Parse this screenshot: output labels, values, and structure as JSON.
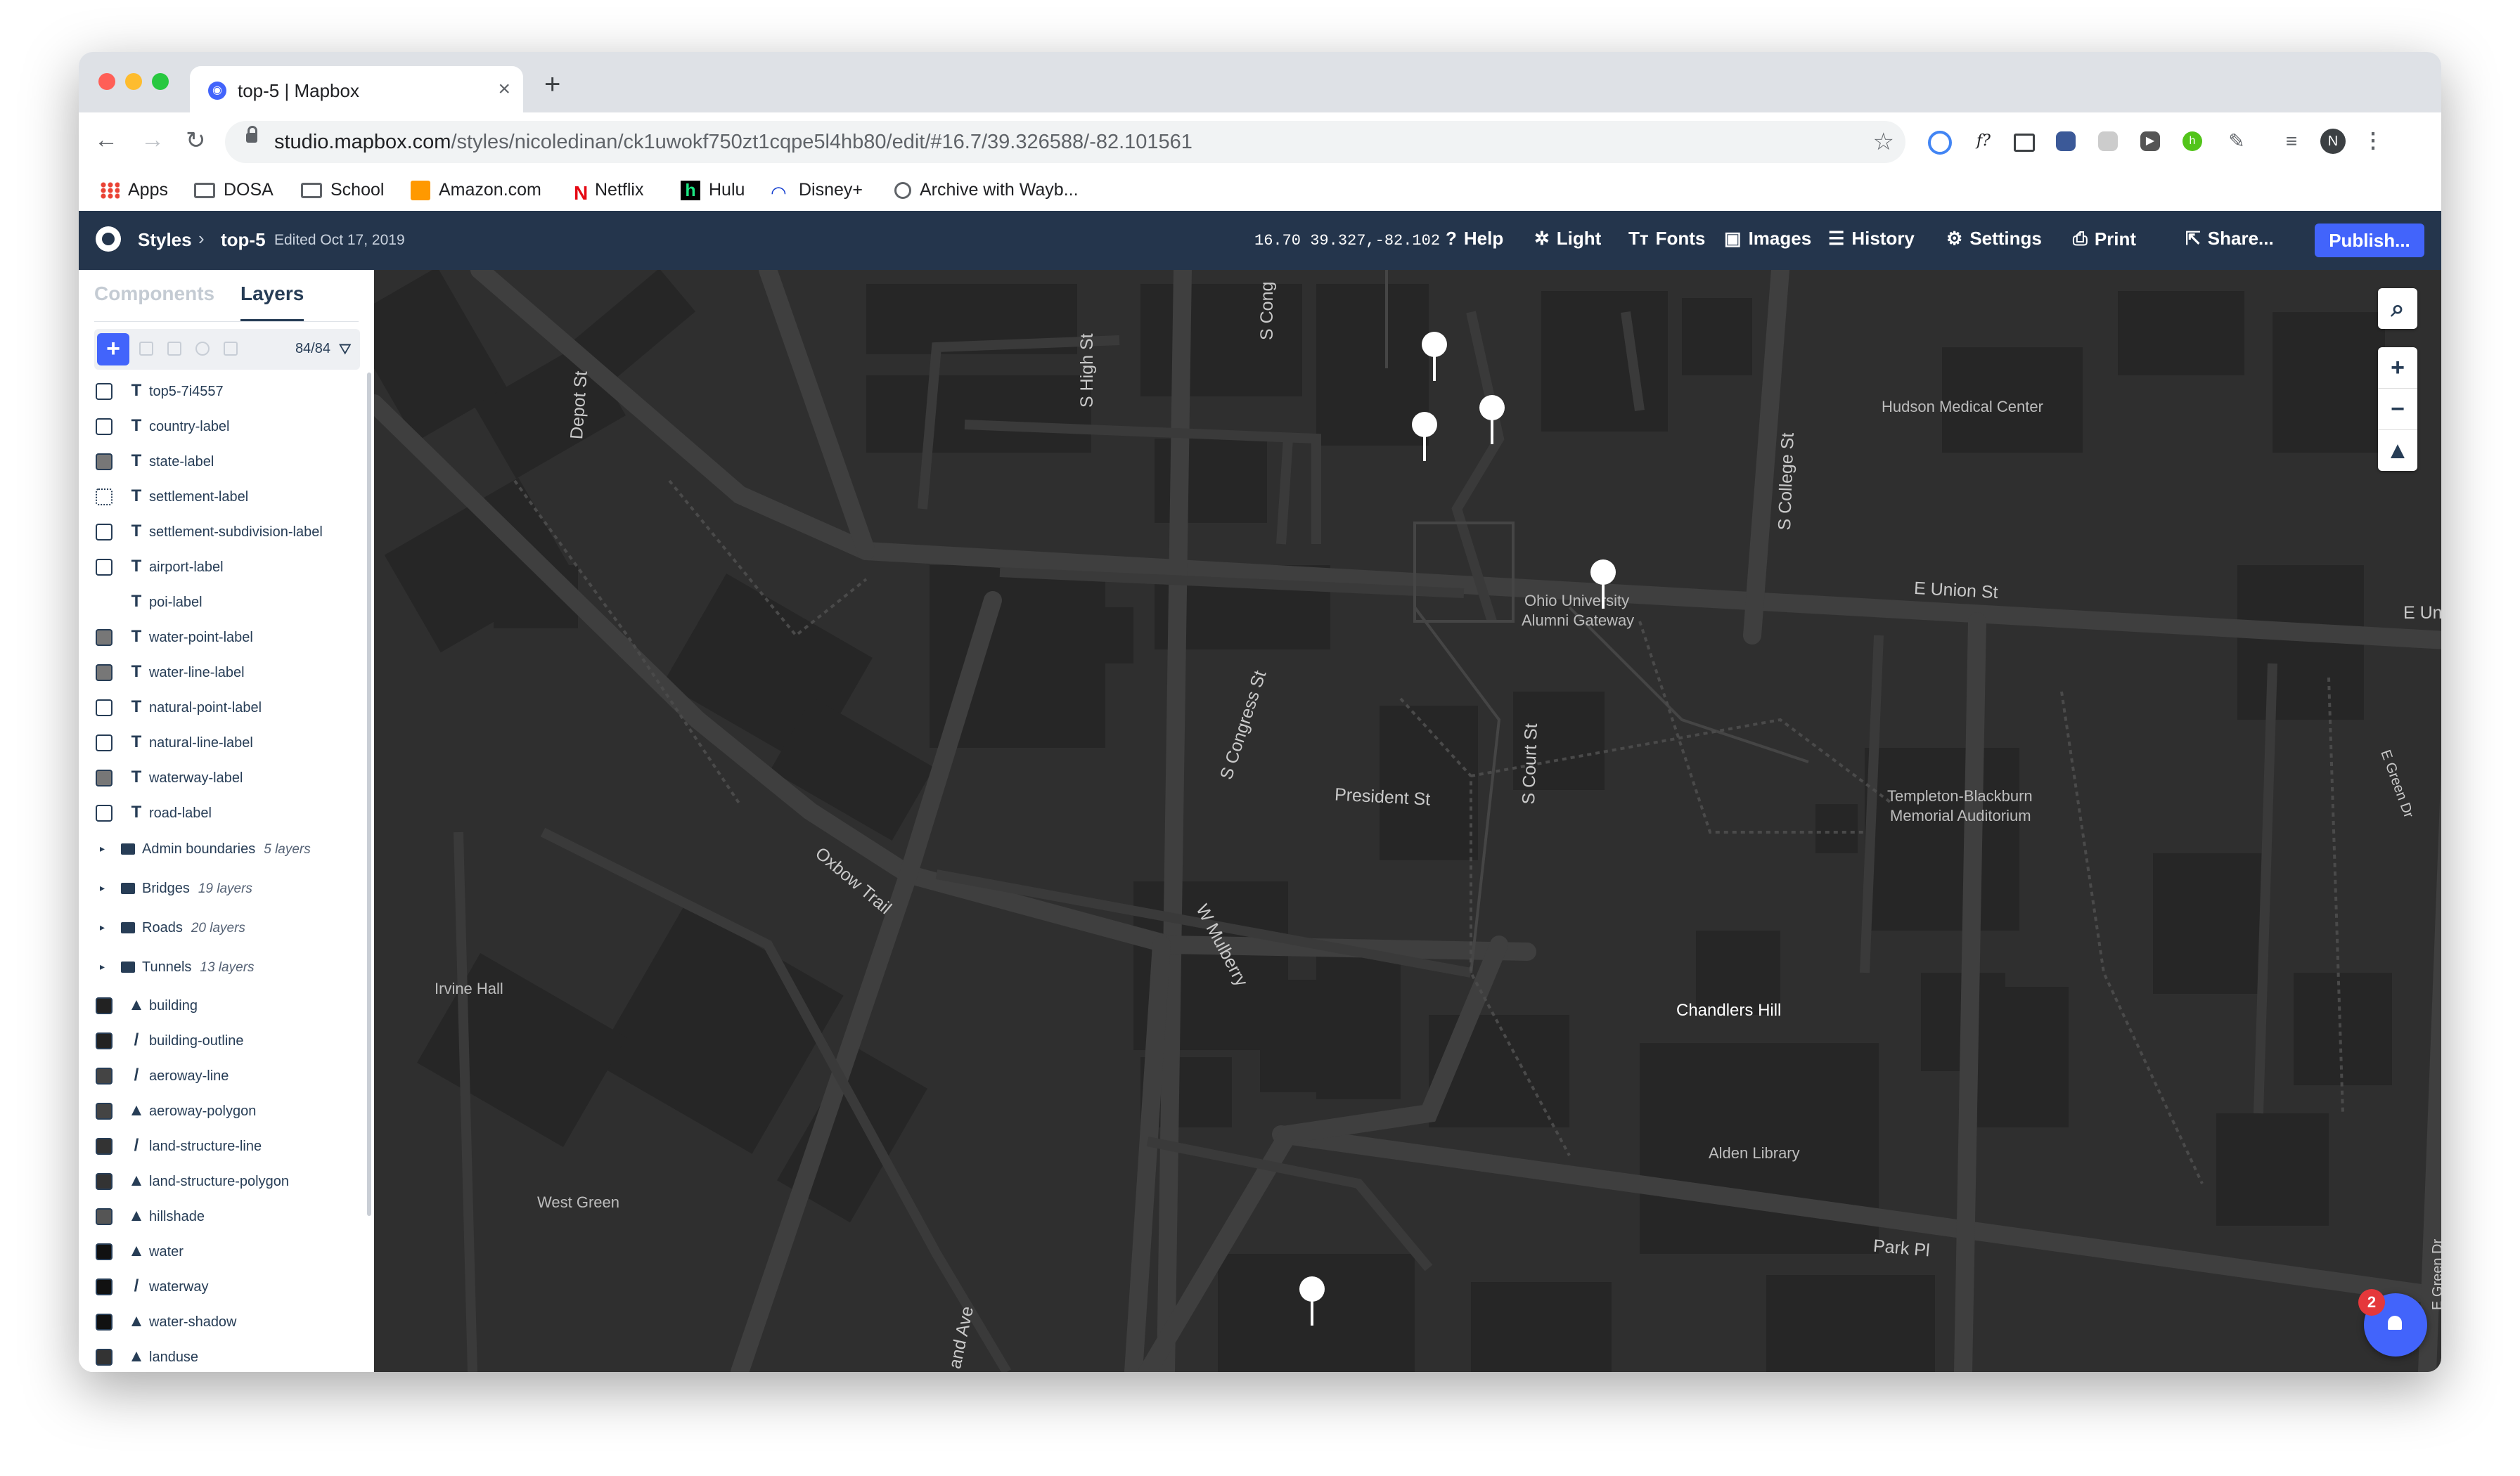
{
  "browser": {
    "tab_title": "top-5 | Mapbox",
    "tab_close": "×",
    "new_tab": "+",
    "url_host": "studio.mapbox.com",
    "url_path": "/styles/nicoledinan/ck1uwokf750zt1cqpe5l4hb80/edit/#16.7/39.326588/-82.101561",
    "profile_initial": "N",
    "bookmarks": [
      "Apps",
      "DOSA",
      "School",
      "Amazon.com",
      "Netflix",
      "Hulu",
      "Disney+",
      "Archive with Wayb..."
    ]
  },
  "header": {
    "styles_label": "Styles",
    "style_name": "top-5",
    "edited": "Edited Oct 17, 2019",
    "coords": "16.70  39.327,-82.102",
    "help": "Help",
    "light": "Light",
    "fonts": "Fonts",
    "images": "Images",
    "history": "History",
    "settings": "Settings",
    "print": "Print",
    "share": "Share...",
    "publish": "Publish..."
  },
  "sidebar": {
    "tab_components": "Components",
    "tab_layers": "Layers",
    "layer_count": "84/84",
    "add_icon": "+",
    "layers": [
      {
        "name": "top5-7i4557",
        "type": "T",
        "swatch": "#ffffff"
      },
      {
        "name": "country-label",
        "type": "T",
        "swatch": "#ffffff"
      },
      {
        "name": "state-label",
        "type": "T",
        "swatch": "#777777"
      },
      {
        "name": "settlement-label",
        "type": "T",
        "swatch": "#ffffff"
      },
      {
        "name": "settlement-subdivision-label",
        "type": "T",
        "swatch": "#ffffff"
      },
      {
        "name": "airport-label",
        "type": "T",
        "swatch": "#ffffff"
      },
      {
        "name": "poi-label",
        "type": "T",
        "swatch": "#ffffff"
      },
      {
        "name": "water-point-label",
        "type": "T",
        "swatch": "#777777"
      },
      {
        "name": "water-line-label",
        "type": "T",
        "swatch": "#777777"
      },
      {
        "name": "natural-point-label",
        "type": "T",
        "swatch": "#ffffff"
      },
      {
        "name": "natural-line-label",
        "type": "T",
        "swatch": "#ffffff"
      },
      {
        "name": "waterway-label",
        "type": "T",
        "swatch": "#777777"
      },
      {
        "name": "road-label",
        "type": "T",
        "swatch": "#ffffff"
      }
    ],
    "groups": [
      {
        "name": "Admin boundaries",
        "count": "5 layers"
      },
      {
        "name": "Bridges",
        "count": "19 layers"
      },
      {
        "name": "Roads",
        "count": "20 layers"
      },
      {
        "name": "Tunnels",
        "count": "13 layers"
      }
    ],
    "layers2": [
      {
        "name": "building",
        "type": "fill",
        "swatch": "#222222"
      },
      {
        "name": "building-outline",
        "type": "line",
        "swatch": "#222222"
      },
      {
        "name": "aeroway-line",
        "type": "line",
        "swatch": "#444444"
      },
      {
        "name": "aeroway-polygon",
        "type": "fill",
        "swatch": "#444444"
      },
      {
        "name": "land-structure-line",
        "type": "line",
        "swatch": "#333333"
      },
      {
        "name": "land-structure-polygon",
        "type": "fill",
        "swatch": "#333333"
      },
      {
        "name": "hillshade",
        "type": "fill",
        "swatch": "#555555"
      },
      {
        "name": "water",
        "type": "fill",
        "swatch": "#111111"
      },
      {
        "name": "waterway",
        "type": "line",
        "swatch": "#111111"
      },
      {
        "name": "water-shadow",
        "type": "fill",
        "swatch": "#111111"
      },
      {
        "name": "landuse",
        "type": "fill",
        "swatch": "#333333"
      }
    ]
  },
  "map": {
    "labels": {
      "hudson": "Hudson Medical Center",
      "gateway1": "Ohio University",
      "gateway2": "Alumni Gateway",
      "templeton1": "Templeton-Blackburn",
      "templeton2": "Memorial Auditorium",
      "chandlers": "Chandlers Hill",
      "alden": "Alden Library",
      "irvine": "Irvine Hall",
      "westgreen": "West Green"
    },
    "streets": {
      "union": "E Union St",
      "union2": "E Un",
      "president": "President St",
      "park": "Park Pl",
      "college": "S College St",
      "court": "S Court St",
      "congress": "S Congress St",
      "congress_top": "S Cong",
      "high": "S High St",
      "depot": "Depot St",
      "oxbow": "Oxbow Trail",
      "mulberry": "W Mulberry",
      "green": "E Green Dr",
      "green2": "E Green Dr",
      "ave": "and Ave"
    },
    "notifications": "2",
    "zoom_in": "+",
    "zoom_out": "−"
  }
}
